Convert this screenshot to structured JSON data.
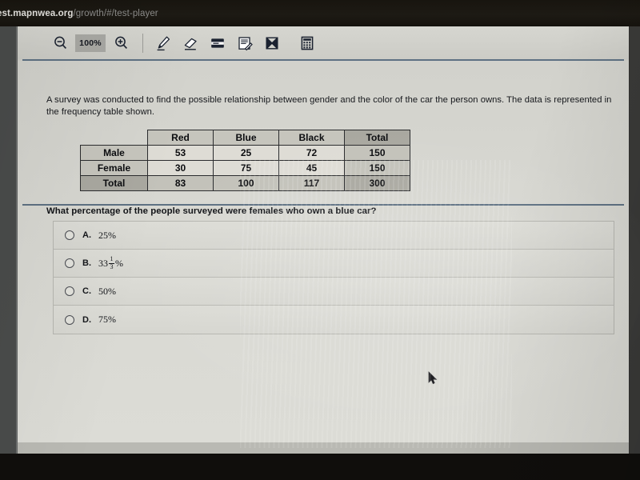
{
  "browser": {
    "url_host": "est.mapnwea.org",
    "url_path": "/growth/#/test-player"
  },
  "toolbar": {
    "zoom_out_icon": "zoom-out-icon",
    "zoom_level": "100%",
    "zoom_in_icon": "zoom-in-icon",
    "highlighter_icon": "highlighter-icon",
    "eraser_icon": "eraser-icon",
    "masking_icon": "line-reader-icon",
    "notepad_icon": "notepad-icon",
    "answer_eliminator_icon": "answer-eliminator-icon",
    "calculator_icon": "calculator-icon"
  },
  "question": {
    "stem": "A survey was conducted to find the possible relationship between gender and the color of the car the person owns. The data is represented in the frequency table shown.",
    "prompt": "What percentage of the people surveyed were females who own a blue car?"
  },
  "table": {
    "corner": "",
    "column_headers": [
      "Red",
      "Blue",
      "Black",
      "Total"
    ],
    "rows": [
      {
        "label": "Male",
        "values": [
          "53",
          "25",
          "72",
          "150"
        ]
      },
      {
        "label": "Female",
        "values": [
          "30",
          "75",
          "45",
          "150"
        ]
      },
      {
        "label": "Total",
        "values": [
          "83",
          "100",
          "117",
          "300"
        ]
      }
    ]
  },
  "choices": [
    {
      "letter": "A.",
      "text": "25%",
      "type": "plain"
    },
    {
      "letter": "B.",
      "whole": "33",
      "num": "1",
      "den": "3",
      "suffix": "%",
      "type": "mixed"
    },
    {
      "letter": "C.",
      "text": "50%",
      "type": "plain"
    },
    {
      "letter": "D.",
      "text": "75%",
      "type": "plain"
    }
  ],
  "colors": {
    "rule": "#5e7183",
    "panel": "#d6d6d0",
    "table_header": "#c6c5bd",
    "table_total": "#a9a8a0"
  }
}
